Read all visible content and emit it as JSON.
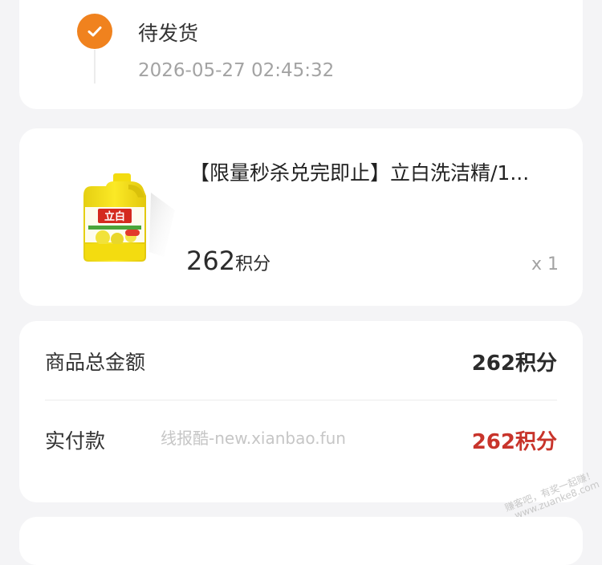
{
  "status": {
    "title": "待发货",
    "time": "2026-05-27 02:45:32",
    "icon": "check-icon",
    "accent": "#f0821e"
  },
  "product": {
    "title": "【限量秒杀兑完即止】立白洗洁精/1...",
    "price_value": "262",
    "price_unit": "积分",
    "quantity": "x 1",
    "image_brand": "立白"
  },
  "summary": {
    "total_label": "商品总金额",
    "total_value": "262积分",
    "paid_label": "实付款",
    "paid_value": "262积分",
    "paid_color": "#c8342b"
  },
  "watermarks": {
    "center": "线报酷-new.xianbao.fun",
    "corner_line1": "赚客吧，有奖一起赚！",
    "corner_line2": "www.zuanke8.com"
  }
}
